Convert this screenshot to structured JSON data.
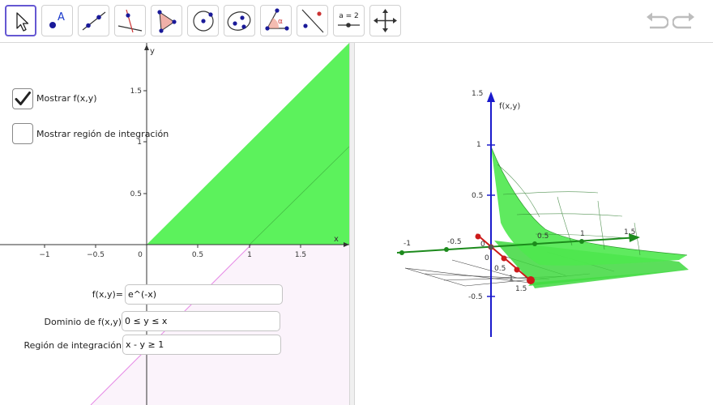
{
  "toolbar": {
    "tools": [
      {
        "name": "move-tool-icon",
        "selected": true
      },
      {
        "name": "point-tool-icon",
        "selected": false
      },
      {
        "name": "line-tool-icon",
        "selected": false
      },
      {
        "name": "perpendicular-line-tool-icon",
        "selected": false
      },
      {
        "name": "polygon-tool-icon",
        "selected": false
      },
      {
        "name": "circle-tool-icon",
        "selected": false
      },
      {
        "name": "conic-tool-icon",
        "selected": false
      },
      {
        "name": "angle-tool-icon",
        "selected": false
      },
      {
        "name": "reflect-tool-icon",
        "selected": false
      },
      {
        "name": "slider-tool-icon",
        "selected": false,
        "label": "a = 2"
      },
      {
        "name": "move-view-tool-icon",
        "selected": false
      }
    ],
    "undo_icon": "undo-icon",
    "redo_icon": "redo-icon"
  },
  "checkboxes": {
    "show_f": {
      "label": "Mostrar f(x,y)",
      "checked": true
    },
    "show_region": {
      "label": "Mostrar región de integración",
      "checked": false
    }
  },
  "inputs": {
    "function": {
      "label": "f(x,y)=",
      "value": "e^(-x)"
    },
    "domain": {
      "label": "Dominio de f(x,y)",
      "value": "0 ≤ y ≤ x"
    },
    "region": {
      "label": "Región de integración",
      "value": "x - y ≥ 1"
    }
  },
  "graph2d": {
    "x_axis_label": "x",
    "y_axis_label": "y",
    "x_ticks": [
      "−1",
      "−0.5",
      "0",
      "0.5",
      "1",
      "1.5"
    ],
    "y_ticks": [
      "1.5",
      "1",
      "0.5"
    ],
    "colors": {
      "domain_fill": "#5cf25c",
      "region_fill": "#fbf3fb",
      "region_line": "#e46ce4",
      "axis": "#333333"
    }
  },
  "graph3d": {
    "z_axis_label": "f(x,y)",
    "z_ticks": [
      "1.5",
      "1",
      "0.5",
      "-0.5"
    ],
    "y_ticks": [
      "-1",
      "-0.5",
      "0",
      "0.5",
      "1",
      "1.5"
    ],
    "x_ticks": [
      "0",
      "0.5",
      "1",
      "1.5"
    ],
    "colors": {
      "surface": "#4ee84e",
      "z_axis": "#1a1acc",
      "y_axis": "#1c8a1c",
      "x_axis": "#cc1a1a"
    }
  }
}
